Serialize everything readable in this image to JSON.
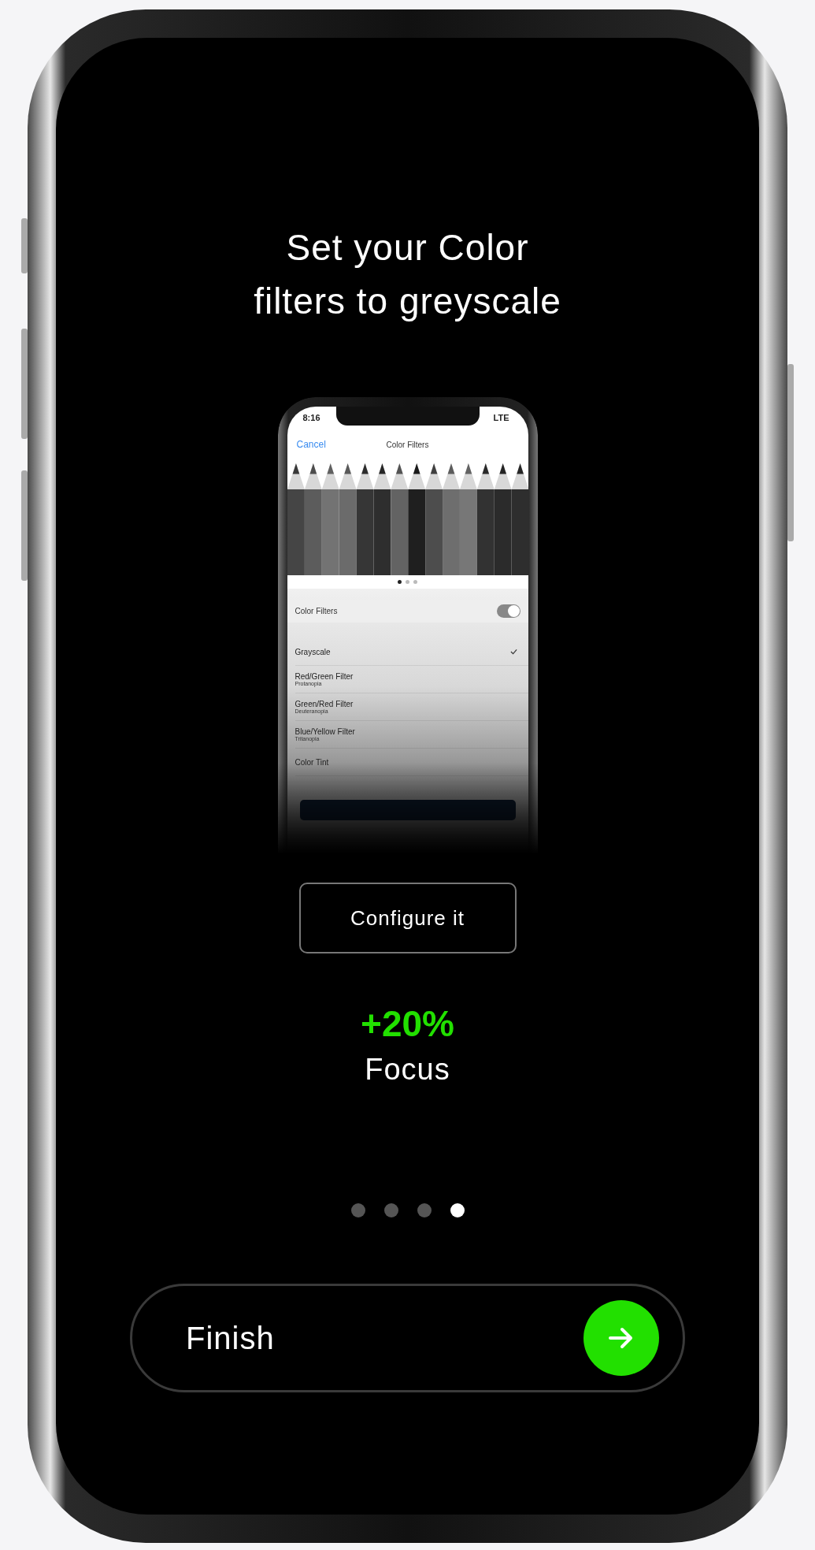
{
  "title": "Set your Color filters to greyscale",
  "preview": {
    "status_time": "8:16",
    "network": "LTE",
    "nav_left": "Cancel",
    "nav_title": "Color Filters",
    "pager": [
      {
        "selected": true
      },
      {
        "selected": false
      },
      {
        "selected": false
      }
    ],
    "toggle": {
      "label": "Color Filters",
      "on": true
    },
    "options": [
      {
        "label": "Grayscale",
        "checked": true
      },
      {
        "label": "Red/Green Filter",
        "subtitle": "Protanopia",
        "checked": false
      },
      {
        "label": "Green/Red Filter",
        "subtitle": "Deuteranopia",
        "checked": false
      },
      {
        "label": "Blue/Yellow Filter",
        "subtitle": "Tritanopia",
        "checked": false
      },
      {
        "label": "Color Tint",
        "checked": false
      }
    ]
  },
  "configure_button": "Configure it",
  "stat": {
    "value": "+20%",
    "label": "Focus"
  },
  "pager": [
    {
      "selected": false
    },
    {
      "selected": false
    },
    {
      "selected": false
    },
    {
      "selected": true
    }
  ],
  "finish_button": "Finish"
}
